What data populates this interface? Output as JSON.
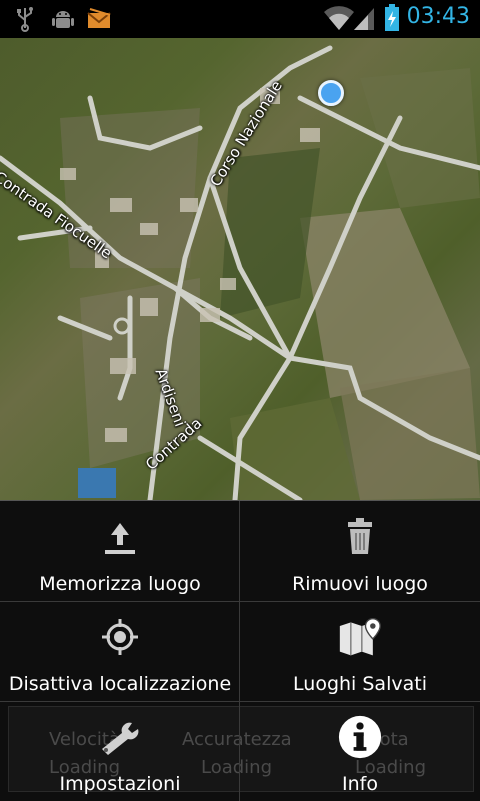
{
  "status_bar": {
    "time": "03:43",
    "icons": [
      "usb-icon",
      "android-debug-icon",
      "mail-icon",
      "wifi-icon",
      "signal-icon",
      "battery-charging-icon"
    ],
    "accent_color": "#33b5e5"
  },
  "map": {
    "street_labels": [
      "Corso Nazionale",
      "Contrada Fiocuelle",
      "Ardiseni",
      "Contrada"
    ]
  },
  "menu": {
    "items": [
      {
        "label": "Memorizza luogo",
        "icon": "upload-icon"
      },
      {
        "label": "Rimuovi luogo",
        "icon": "trash-icon"
      },
      {
        "label": "Disattiva localizzazione",
        "icon": "gps-target-icon"
      },
      {
        "label": "Luoghi Salvati",
        "icon": "map-pin-icon"
      },
      {
        "label": "Impostazioni",
        "icon": "wrench-icon"
      },
      {
        "label": "Info",
        "icon": "info-icon"
      }
    ]
  },
  "underlay": {
    "velocita": "Velocità",
    "accuratezza": "Accuratezza",
    "quota": "Quota",
    "loading": "Loading"
  }
}
